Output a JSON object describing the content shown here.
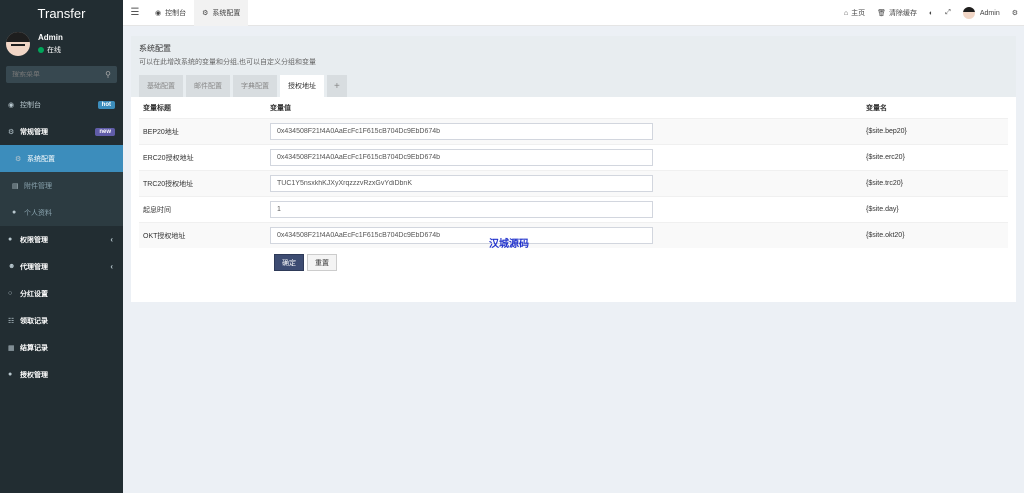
{
  "app": {
    "title": "Transfer"
  },
  "user": {
    "name": "Admin",
    "status": "在线"
  },
  "search": {
    "placeholder": "搜索菜单"
  },
  "sidebar": {
    "items": [
      {
        "label": "控制台",
        "badge": "hot"
      },
      {
        "label": "常规管理",
        "badge": "new"
      },
      {
        "label": "系统配置"
      },
      {
        "label": "附件管理"
      },
      {
        "label": "个人资料"
      },
      {
        "label": "权限管理"
      },
      {
        "label": "代理管理"
      },
      {
        "label": "分红设置"
      },
      {
        "label": "领取记录"
      },
      {
        "label": "结算记录"
      },
      {
        "label": "授权管理"
      }
    ]
  },
  "header": {
    "tabs": [
      {
        "label": "控制台"
      },
      {
        "label": "系统配置"
      }
    ],
    "home": "主页",
    "clear_cache": "清除缓存",
    "user": "Admin"
  },
  "panel": {
    "title": "系统配置",
    "desc": "可以在此增改系统的变量和分组,也可以自定义分组和变量",
    "tabs": [
      "基础配置",
      "邮件配置",
      "字典配置",
      "授权地址",
      "+"
    ]
  },
  "table": {
    "headers": {
      "title": "变量标题",
      "value": "变量值",
      "name": "变量名"
    },
    "rows": [
      {
        "title": "BEP20地址",
        "value": "0x434508F21f4A0AaEcFc1F615cB704Dc9EbD674b",
        "name": "{$site.bep20}"
      },
      {
        "title": "ERC20授权地址",
        "value": "0x434508F21f4A0AaEcFc1F615cB704Dc9EbD674b",
        "name": "{$site.erc20}"
      },
      {
        "title": "TRC20授权地址",
        "value": "TUC1Y5nsxkhKJXyXrqzzzvRzxGvYdiDbnK",
        "name": "{$site.trc20}"
      },
      {
        "title": "起息时间",
        "value": "1",
        "name": "{$site.day}"
      },
      {
        "title": "OKT授权地址",
        "value": "0x434508F21f4A0AaEcFc1F615cB704Dc9EbD674b",
        "name": "{$site.okt20}"
      }
    ]
  },
  "buttons": {
    "confirm": "确定",
    "reset": "重置"
  },
  "watermark": "汉城源码"
}
